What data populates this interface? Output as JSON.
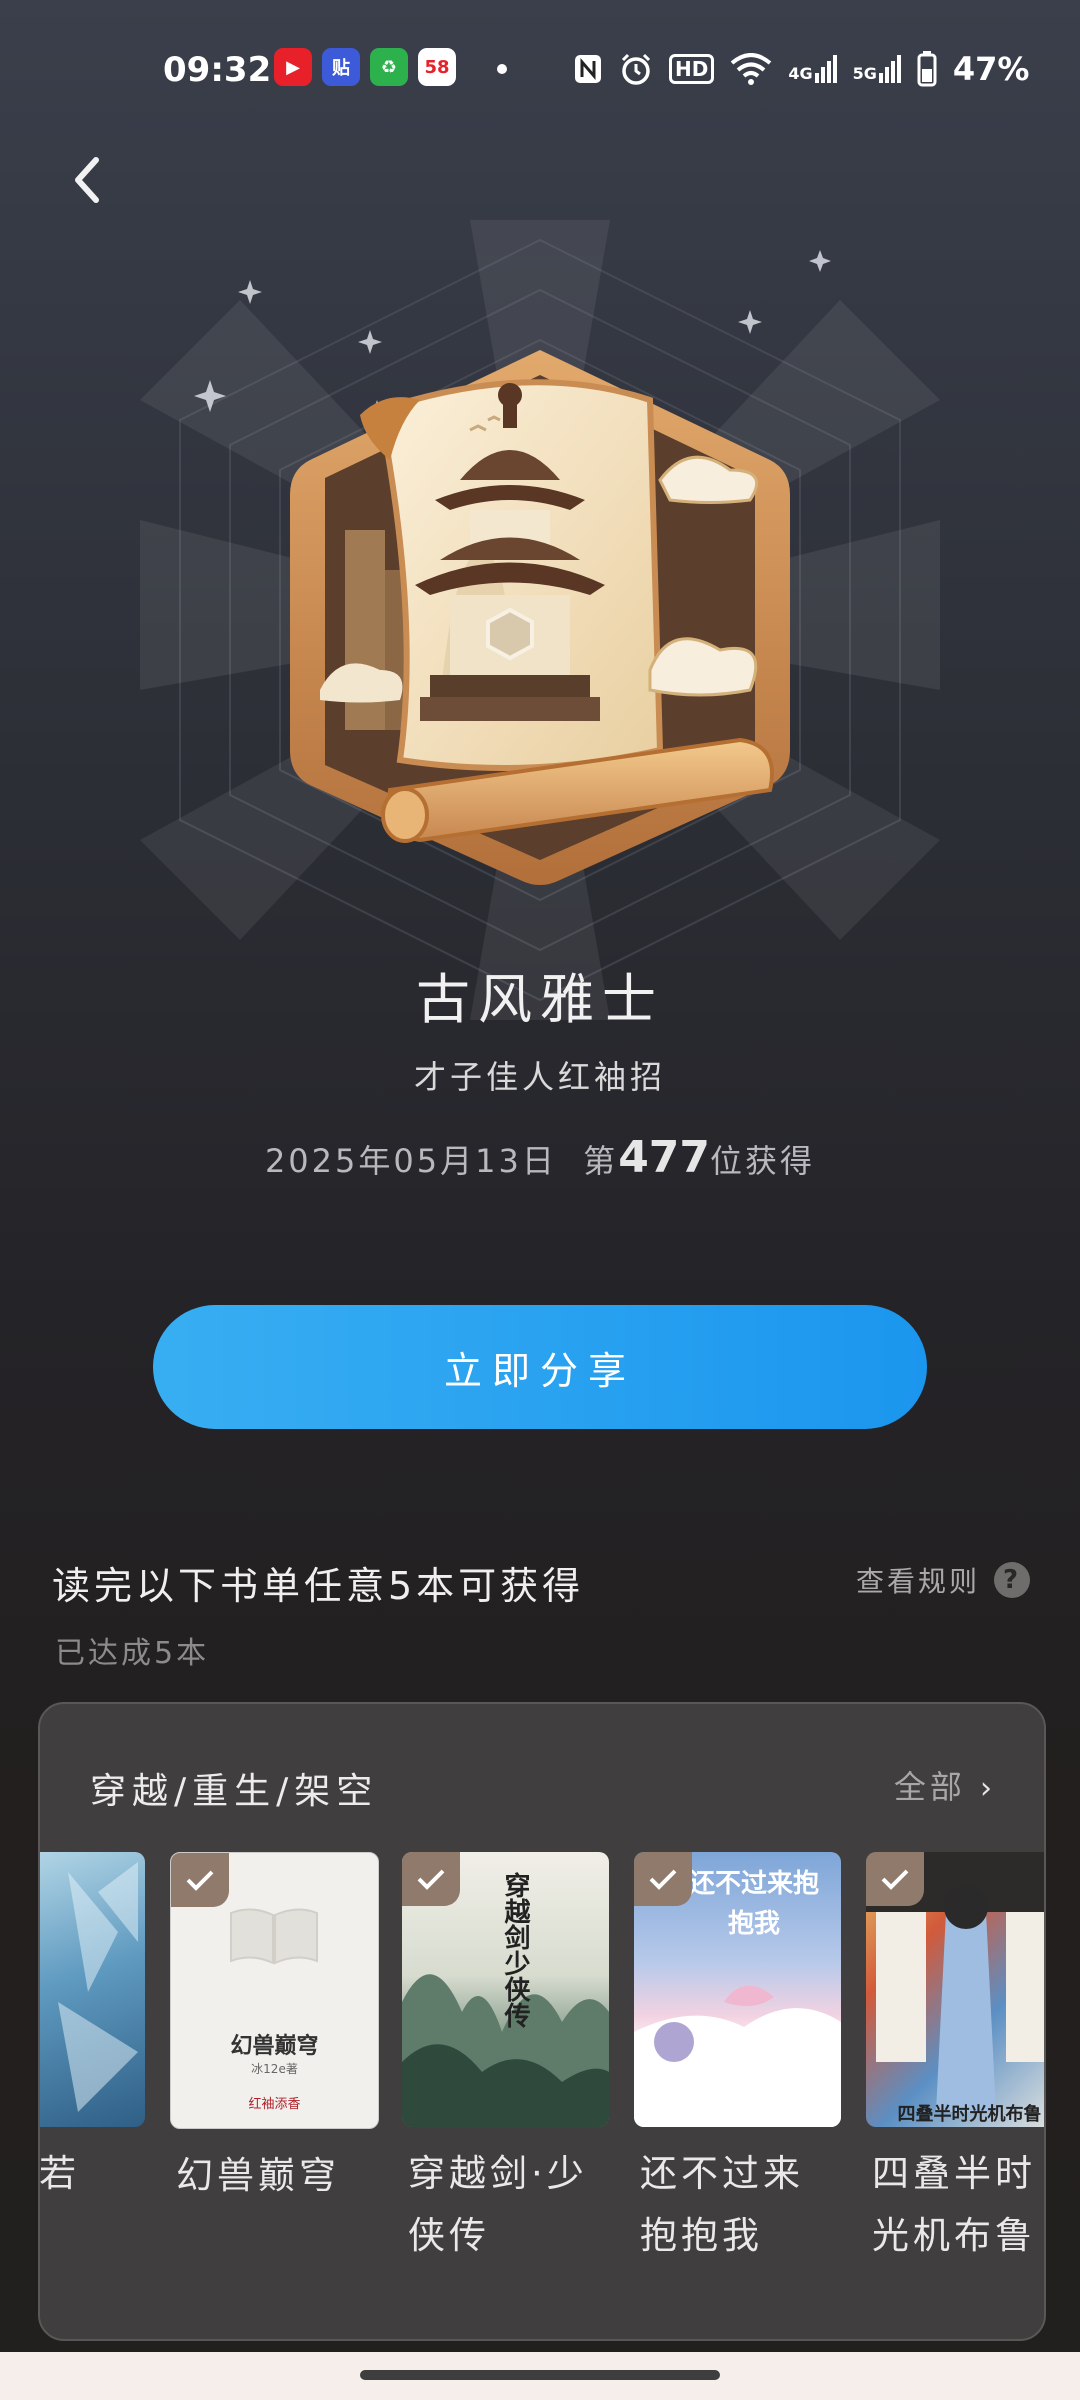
{
  "status_bar": {
    "time": "09:32",
    "app_icons": [
      {
        "name": "video-app-icon",
        "color": "#e8202a",
        "glyph": "▶"
      },
      {
        "name": "tieba-app-icon",
        "color": "#3d5bd9",
        "glyph": "贴"
      },
      {
        "name": "wechat-app-icon",
        "color": "#2db14c",
        "glyph": "♻"
      },
      {
        "name": "58-app-icon",
        "color": "#ffffff",
        "glyph": "58"
      }
    ],
    "net_4g": "4G",
    "net_5g": "5G",
    "hd_label": "HD",
    "battery": "47%"
  },
  "badge": {
    "title": "古风雅士",
    "subtitle": "才子佳人红袖招",
    "date": "2025年05月13日",
    "rank_prefix": "第",
    "rank": "477",
    "rank_suffix": "位获得"
  },
  "share_button": "立即分享",
  "task": {
    "title": "读完以下书单任意5本可获得",
    "rules_label": "查看规则",
    "progress": "已达成5本"
  },
  "booklist": {
    "category": "穿越/重生/架空",
    "all_label": "全部",
    "books": [
      {
        "title_lines": [
          "若",
          ""
        ],
        "checked": false,
        "cover_color": "#5b8fb0"
      },
      {
        "title_lines": [
          "幻兽巅穹",
          ""
        ],
        "checked": true,
        "cover_color": "#f1f0ec",
        "cover_text": "幻兽巅穹",
        "cover_author": "冰12e著",
        "cover_publisher": "红袖添香"
      },
      {
        "title_lines": [
          "穿越剑·少",
          "侠传"
        ],
        "checked": true,
        "cover_color": "#dfe3d9",
        "cover_text": "穿越剑少侠传"
      },
      {
        "title_lines": [
          "还不过来",
          "抱抱我"
        ],
        "checked": true,
        "cover_color": "#8fb4de",
        "cover_text": "还不过来抱抱我"
      },
      {
        "title_lines": [
          "四叠半时",
          "光机布鲁"
        ],
        "checked": true,
        "cover_color": "#d9c8b0",
        "cover_text": "四叠半时光机布鲁"
      }
    ]
  },
  "colors": {
    "share_button": "#1b96ee",
    "check_badge": "#8f7a6b",
    "card_bg": "#403e3e"
  }
}
